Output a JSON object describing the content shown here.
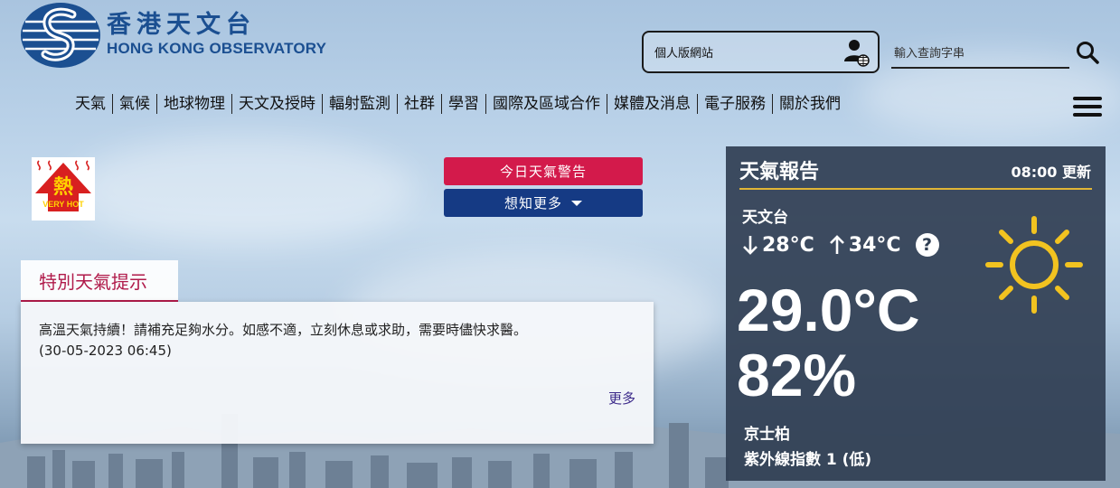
{
  "header": {
    "logo_zh": "香港天文台",
    "logo_en": "HONG KONG OBSERVATORY",
    "personal_site": "個人版網站",
    "search_placeholder": "輸入查詢字串"
  },
  "nav": {
    "items": [
      "天氣",
      "氣候",
      "地球物理",
      "天文及授時",
      "輻射監測",
      "社群",
      "學習",
      "國際及區域合作",
      "媒體及消息",
      "電子服務",
      "關於我們"
    ]
  },
  "warning_icon": {
    "label_zh": "熱",
    "label_en": "VERY HOT"
  },
  "buttons": {
    "today_warning": "今日天氣警告",
    "learn_more": "想知更多"
  },
  "special_tips": {
    "title": "特別天氣提示",
    "text": "高溫天氣持續！請補充足夠水分。如感不適，立刻休息或求助，需要時儘快求醫。",
    "timestamp": "(30-05-2023 06:45)",
    "more": "更多"
  },
  "weather_report": {
    "title": "天氣報告",
    "update_time": "08:00 更新",
    "station": "天文台",
    "min_temp": "28°C",
    "max_temp": "34°C",
    "help": "?",
    "temperature": "29.0°C",
    "humidity": "82%",
    "uv_station": "京士柏",
    "uv_index": "紫外線指數 1 (低)"
  },
  "colors": {
    "brand_blue": "#1b4f91",
    "warning_red": "#d31a4b",
    "button_navy": "#153a84",
    "panel_bg": "#303e52",
    "accent_gold": "#e0b536",
    "tips_red": "#b01a4a"
  }
}
